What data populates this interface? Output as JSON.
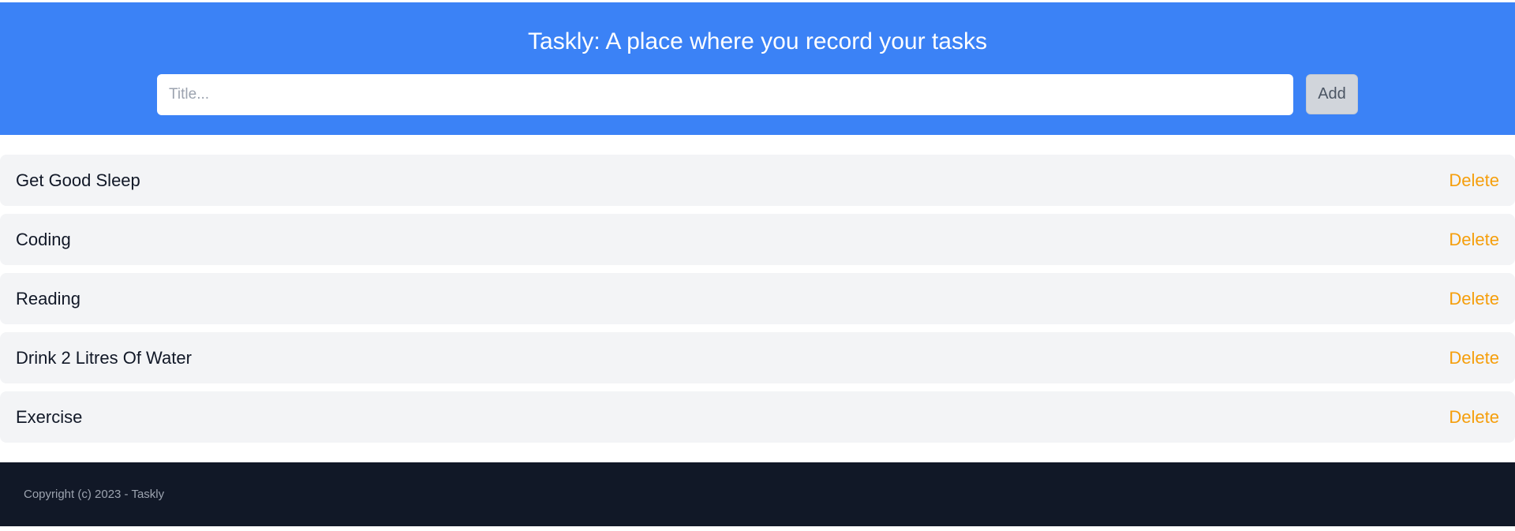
{
  "colors": {
    "header_background": "#3b82f6",
    "delete_text": "#f59e0b",
    "footer_background": "#111827",
    "task_background": "#f3f4f6"
  },
  "header": {
    "title": "Taskly: A place where you record your tasks",
    "input_placeholder": "Title...",
    "input_value": "",
    "add_label": "Add"
  },
  "tasks": [
    {
      "title": "Get Good Sleep",
      "delete_label": "Delete"
    },
    {
      "title": "Coding",
      "delete_label": "Delete"
    },
    {
      "title": "Reading",
      "delete_label": "Delete"
    },
    {
      "title": "Drink 2 Litres Of Water",
      "delete_label": "Delete"
    },
    {
      "title": "Exercise",
      "delete_label": "Delete"
    }
  ],
  "footer": {
    "copyright": "Copyright (c) 2023 - Taskly"
  }
}
